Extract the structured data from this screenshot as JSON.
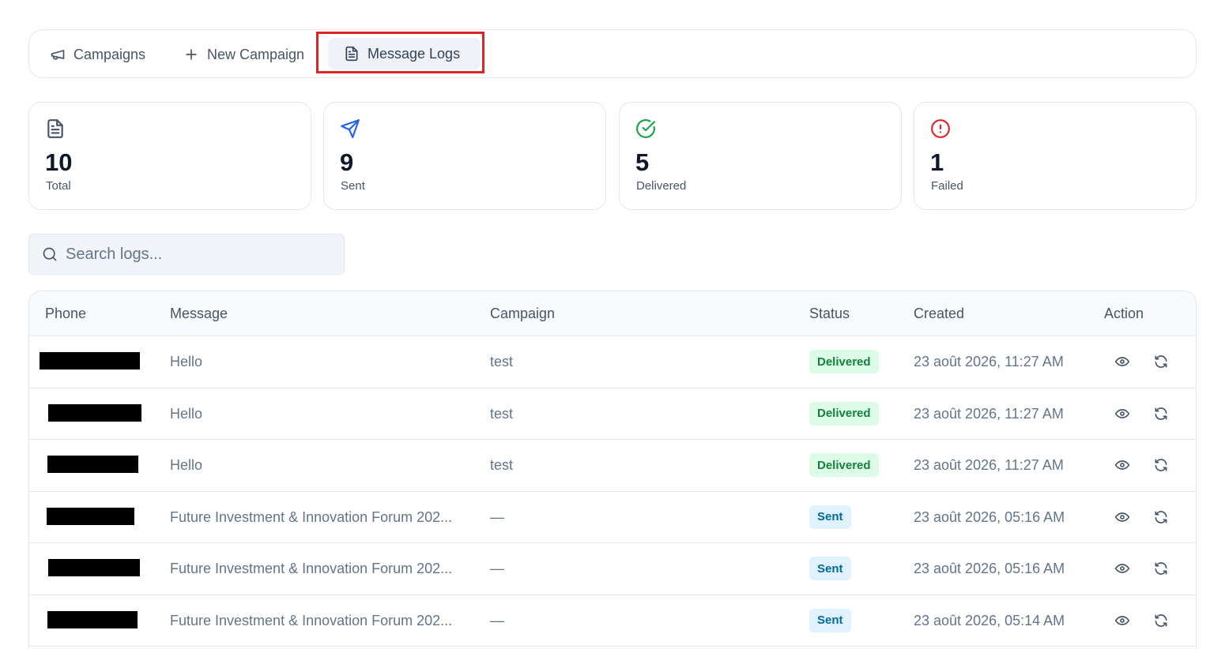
{
  "tabs": {
    "campaigns": "Campaigns",
    "new_campaign": "New Campaign",
    "message_logs": "Message Logs"
  },
  "stats": [
    {
      "value": "10",
      "label": "Total",
      "icon": "file-text-icon",
      "color": "#475569"
    },
    {
      "value": "9",
      "label": "Sent",
      "icon": "send-icon",
      "color": "#2563eb"
    },
    {
      "value": "5",
      "label": "Delivered",
      "icon": "check-circle-icon",
      "color": "#16a34a"
    },
    {
      "value": "1",
      "label": "Failed",
      "icon": "alert-circle-icon",
      "color": "#dc2626"
    }
  ],
  "search": {
    "placeholder": "Search logs..."
  },
  "table": {
    "headers": {
      "phone": "Phone",
      "message": "Message",
      "campaign": "Campaign",
      "status": "Status",
      "created": "Created",
      "action": "Action"
    },
    "rows": [
      {
        "message": "Hello",
        "campaign": "test",
        "status": "Delivered",
        "created": "23 août 2026, 11:27 AM"
      },
      {
        "message": "Hello",
        "campaign": "test",
        "status": "Delivered",
        "created": "23 août 2026, 11:27 AM"
      },
      {
        "message": "Hello",
        "campaign": "test",
        "status": "Delivered",
        "created": "23 août 2026, 11:27 AM"
      },
      {
        "message": "Future Investment & Innovation Forum 202...",
        "campaign": "—",
        "status": "Sent",
        "created": "23 août 2026, 05:16 AM"
      },
      {
        "message": "Future Investment & Innovation Forum 202...",
        "campaign": "—",
        "status": "Sent",
        "created": "23 août 2026, 05:16 AM"
      },
      {
        "message": "Future Investment & Innovation Forum 202...",
        "campaign": "—",
        "status": "Sent",
        "created": "23 août 2026, 05:14 AM"
      }
    ]
  }
}
